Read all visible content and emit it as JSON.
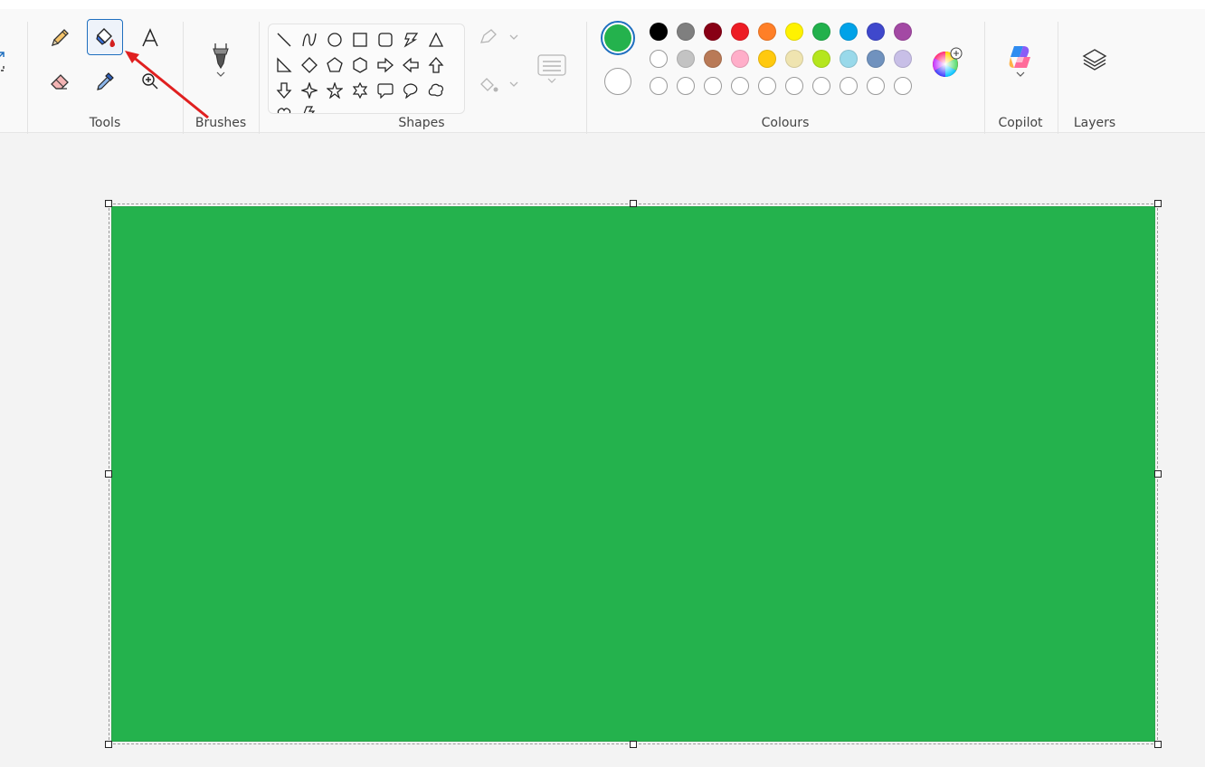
{
  "groups": {
    "tools": "Tools",
    "brushes": "Brushes",
    "shapes": "Shapes",
    "colours": "Colours",
    "copilot": "Copilot",
    "layers": "Layers"
  },
  "tools": {
    "selected": "fill-tool",
    "items": [
      "pencil-icon",
      "fill-bucket-icon",
      "text-icon",
      "eraser-icon",
      "color-picker-icon",
      "magnifier-icon"
    ]
  },
  "shapes": [
    "line",
    "curve",
    "oval",
    "rectangle",
    "rounded-rectangle",
    "polygon",
    "triangle",
    "right-triangle",
    "diamond",
    "pentagon",
    "hexagon",
    "right-arrow",
    "left-arrow",
    "up-arrow",
    "down-arrow",
    "four-point-star",
    "five-point-star",
    "six-point-star",
    "rounded-callout",
    "oval-callout",
    "cloud-callout",
    "heart",
    "lightning"
  ],
  "colours": {
    "primary": "#24b24d",
    "secondary": "#ffffff",
    "palette_row1": [
      "#000000",
      "#7f7f7f",
      "#880015",
      "#ed1c24",
      "#ff7f27",
      "#fff200",
      "#22b14c",
      "#00a2e8",
      "#3f48cc",
      "#a349a4"
    ],
    "palette_row2": [
      "#ffffff",
      "#c3c3c3",
      "#b97a57",
      "#ffaec9",
      "#ffc90e",
      "#efe4b0",
      "#b5e61d",
      "#99d9ea",
      "#7092be",
      "#c8bfe7"
    ],
    "palette_row3_empty_slots": 10
  },
  "canvas": {
    "fill_color": "#24b24d"
  },
  "annotation": {
    "arrow_color": "#e02020",
    "points_to": "fill-tool"
  }
}
